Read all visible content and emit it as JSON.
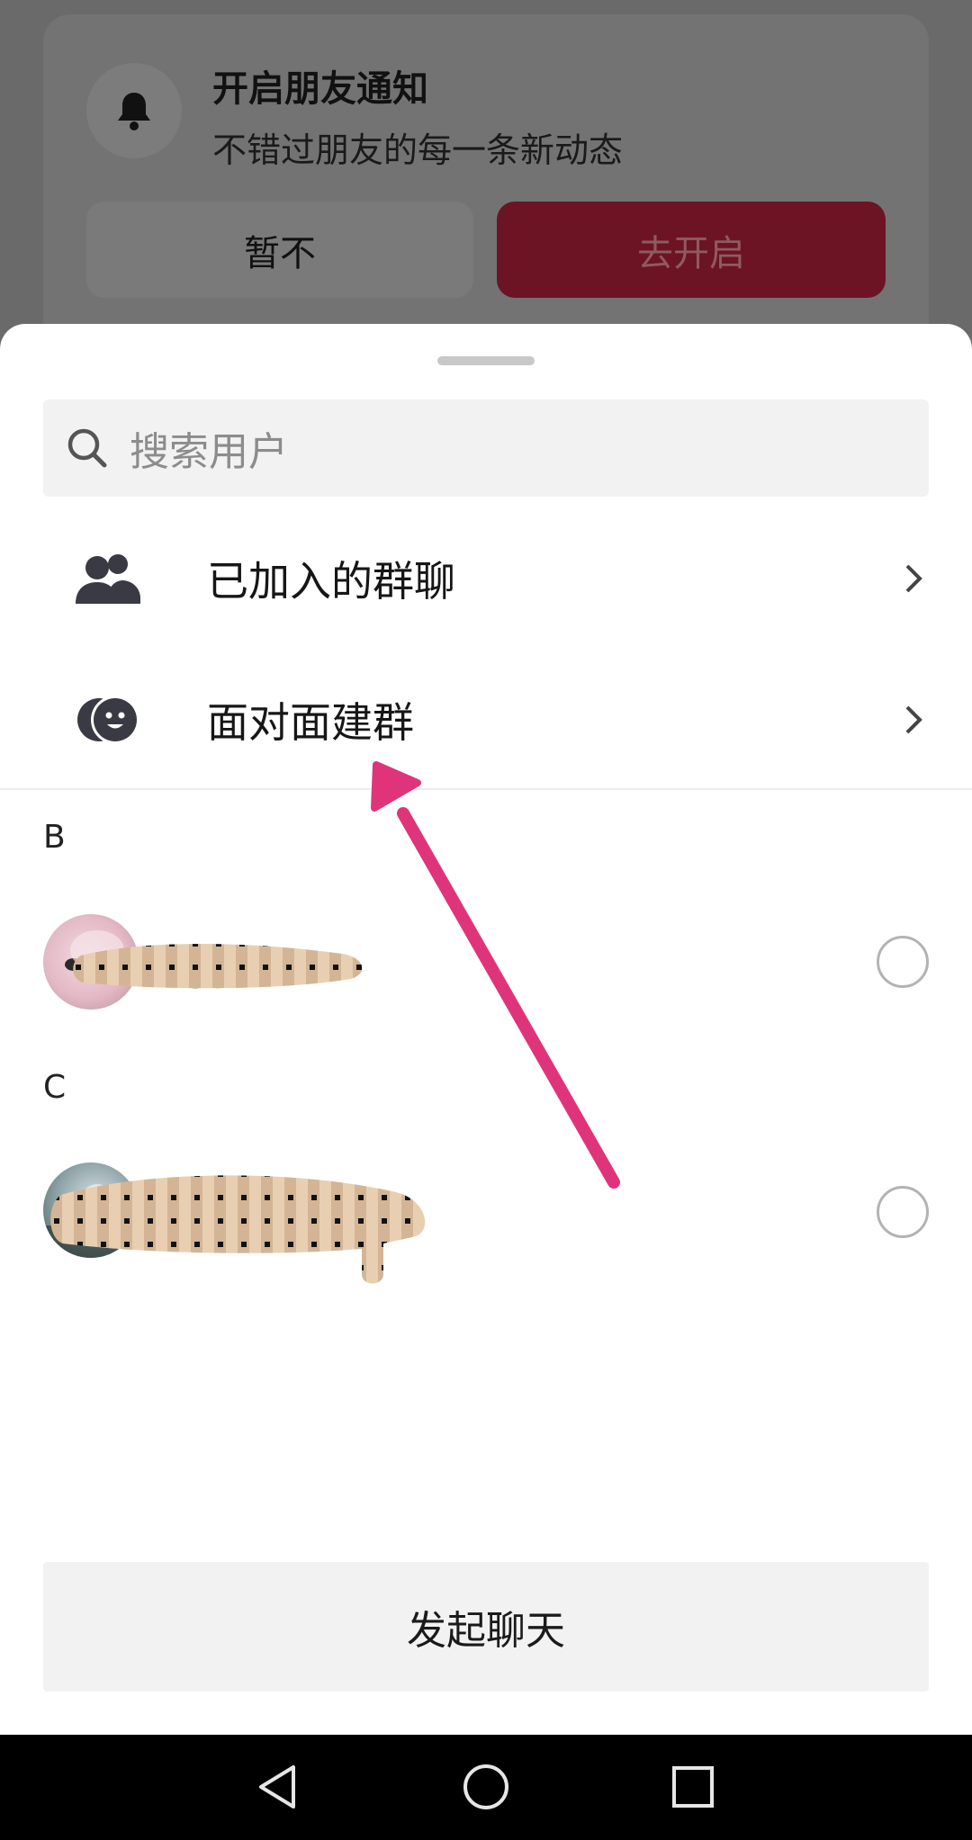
{
  "notification": {
    "title": "开启朋友通知",
    "subtitle": "不错过朋友的每一条新动态",
    "later_label": "暂不",
    "open_label": "去开启"
  },
  "search": {
    "placeholder": "搜索用户"
  },
  "menu": {
    "joined_groups": "已加入的群聊",
    "face_to_face": "面对面建群"
  },
  "contacts": {
    "sections": [
      {
        "letter": "B",
        "name": ""
      },
      {
        "letter": "C",
        "name": ""
      }
    ]
  },
  "start_chat_label": "发起聊天",
  "colors": {
    "accent_red": "#6c1423",
    "annotation_arrow": "#e0347a"
  },
  "icons": {
    "notification": "bell-icon",
    "search": "search-icon",
    "groups": "group-icon",
    "face_to_face": "face-to-face-icon",
    "chevron": "chevron-right-icon",
    "nav_back": "back-triangle-icon",
    "nav_home": "home-circle-icon",
    "nav_recents": "recents-square-icon"
  }
}
